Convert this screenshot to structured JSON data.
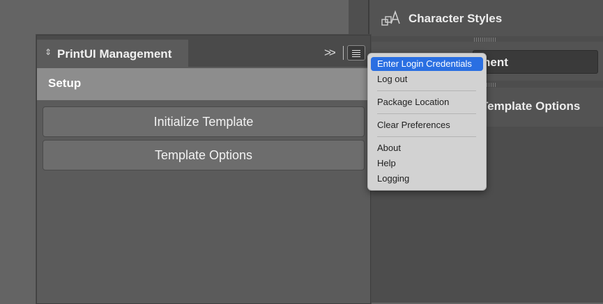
{
  "dock": {
    "row1_label": "Character Styles",
    "row2_label": "Management",
    "row3_label": "Template Options",
    "row1_icon": "character-styles-icon"
  },
  "panel": {
    "title": "PrintUI Management",
    "section": "Setup",
    "buttons": [
      "Initialize Template",
      "Template Options"
    ],
    "collapse_icon": "double-chevron-right-icon",
    "menu_icon": "hamburger-menu-icon"
  },
  "flyout": {
    "items": [
      "Enter Login Credentials",
      "Log out",
      "Package Location",
      "Clear Preferences",
      "About",
      "Help",
      "Logging"
    ],
    "active_item": "Enter Login Credentials"
  },
  "colors": {
    "highlight": "#2a6fe2",
    "menu_bg": "#d2d2d2",
    "panel_bg": "#5b5b5b",
    "setup_bar": "#8d8d8d"
  }
}
